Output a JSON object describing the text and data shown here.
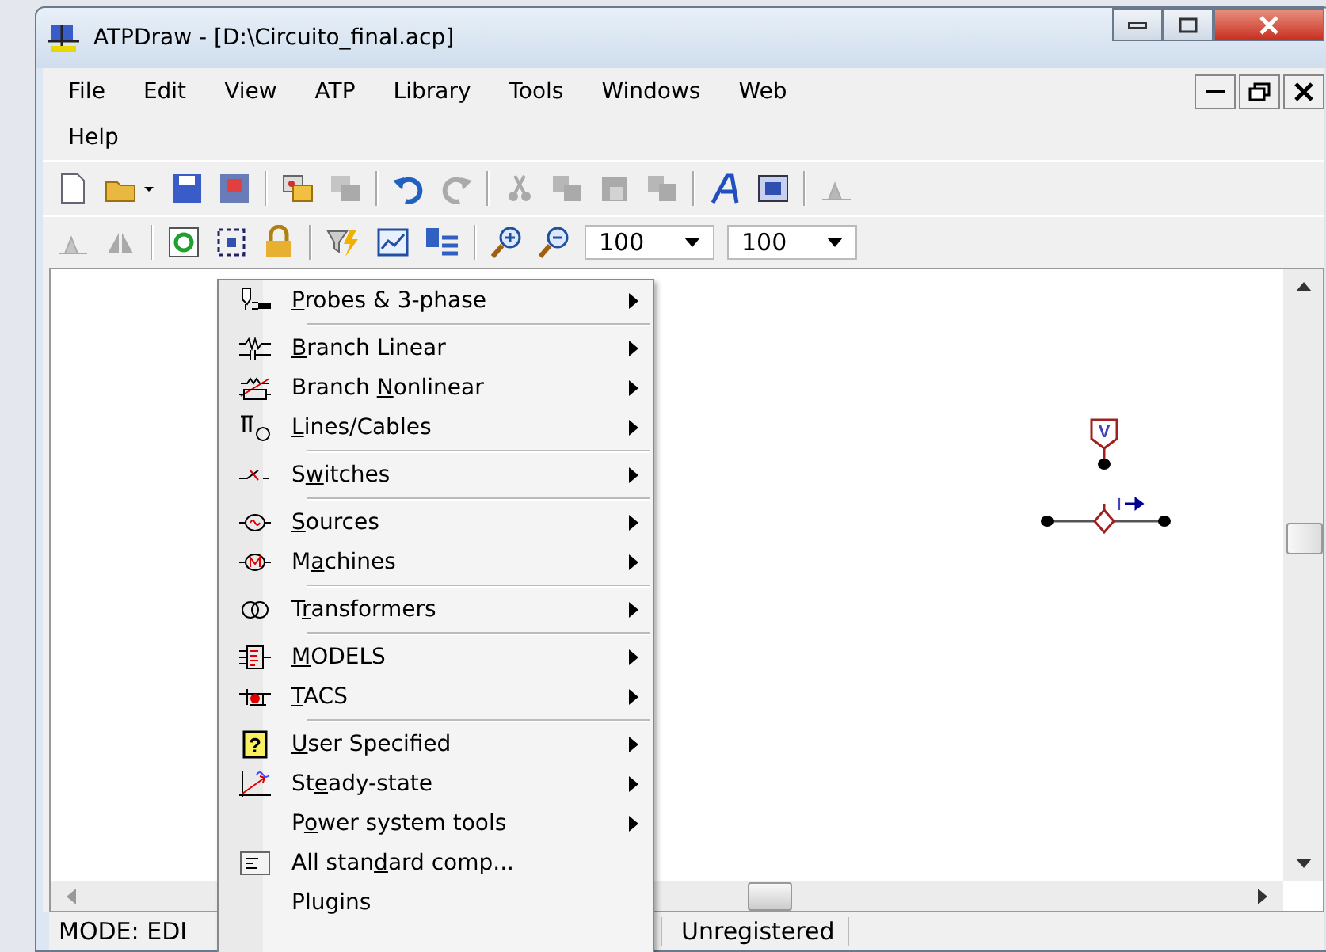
{
  "window": {
    "title": "ATPDraw - [D:\\Circuito_final.acp]"
  },
  "menubar": {
    "items": [
      {
        "label": "File"
      },
      {
        "label": "Edit"
      },
      {
        "label": "View"
      },
      {
        "label": "ATP"
      },
      {
        "label": "Library"
      },
      {
        "label": "Tools"
      },
      {
        "label": "Windows"
      },
      {
        "label": "Web"
      },
      {
        "label": "Help"
      }
    ]
  },
  "zoom_boxes": [
    {
      "value": "100"
    },
    {
      "value": "100"
    }
  ],
  "canvas": {
    "probe_label": "V",
    "current_label": "I"
  },
  "status_bar": {
    "mode": "MODE: EDI",
    "registration": "Unregistered"
  },
  "context_menu": {
    "groups": [
      [
        {
          "kind": "probe",
          "key": "P",
          "after": "robes & 3-phase",
          "submenu": true
        }
      ],
      [
        {
          "kind": "branch",
          "key": "B",
          "after": "ranch Linear",
          "submenu": true
        },
        {
          "kind": "nonlinear",
          "before": "Branch ",
          "key": "N",
          "after": "onlinear",
          "submenu": true
        },
        {
          "kind": "lines",
          "key": "L",
          "after": "ines/Cables",
          "submenu": true
        }
      ],
      [
        {
          "kind": "switch",
          "before": "S",
          "key": "w",
          "after": "itches",
          "submenu": true
        }
      ],
      [
        {
          "kind": "source",
          "key": "S",
          "after": "ources",
          "submenu": true
        },
        {
          "kind": "machine",
          "before": "M",
          "key": "a",
          "after": "chines",
          "submenu": true
        }
      ],
      [
        {
          "kind": "transformer",
          "before": "T",
          "key": "r",
          "after": "ansformers",
          "submenu": true
        }
      ],
      [
        {
          "kind": "models",
          "key": "M",
          "after": "ODELS",
          "submenu": true
        },
        {
          "kind": "tacs",
          "key": "T",
          "after": "ACS",
          "submenu": true
        }
      ],
      [
        {
          "kind": "user",
          "icon_text": "?",
          "key": "U",
          "after": "ser Specified",
          "submenu": true
        },
        {
          "kind": "steady",
          "before": "St",
          "key": "e",
          "after": "ady-state",
          "submenu": true
        },
        {
          "kind": "none",
          "before": "P",
          "key": "o",
          "after": "wer system tools",
          "submenu": true
        },
        {
          "kind": "list",
          "before": "All stan",
          "key": "d",
          "after": "ard comp...",
          "submenu": false
        },
        {
          "kind": "none",
          "before": "Plugins",
          "submenu": false
        }
      ]
    ]
  }
}
